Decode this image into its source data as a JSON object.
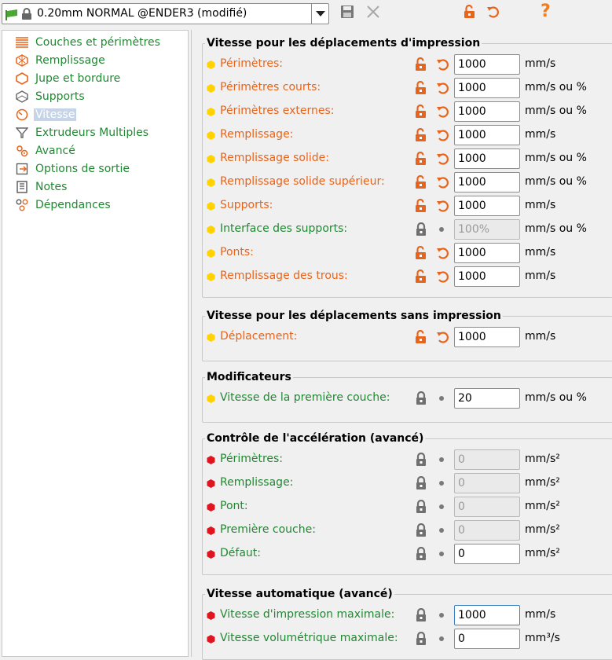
{
  "preset": {
    "name": "0.20mm NORMAL @ENDER3 (modifié)"
  },
  "colors": {
    "modified": "#e8641b",
    "system": "#218833",
    "bullet_yellow": "#ffd200",
    "bullet_red": "#e0141e"
  },
  "sidebar": {
    "items": [
      {
        "label": "Couches et périmètres",
        "icon": "layers-icon"
      },
      {
        "label": "Remplissage",
        "icon": "infill-icon"
      },
      {
        "label": "Jupe et bordure",
        "icon": "skirt-icon"
      },
      {
        "label": "Supports",
        "icon": "support-icon"
      },
      {
        "label": "Vitesse",
        "icon": "speed-icon",
        "selected": true
      },
      {
        "label": "Extrudeurs Multiples",
        "icon": "extruder-icon"
      },
      {
        "label": "Avancé",
        "icon": "advanced-icon"
      },
      {
        "label": "Options de sortie",
        "icon": "output-icon"
      },
      {
        "label": "Notes",
        "icon": "notes-icon"
      },
      {
        "label": "Dépendances",
        "icon": "dependencies-icon"
      }
    ]
  },
  "groups": [
    {
      "title": "Vitesse pour les déplacements d'impression",
      "rows": [
        {
          "label": "Périmètres:",
          "value": "1000",
          "unit": "mm/s",
          "modified": true,
          "bullet": "yellow",
          "enabled": true
        },
        {
          "label": "Périmètres courts:",
          "value": "1000",
          "unit": "mm/s ou %",
          "modified": true,
          "bullet": "yellow",
          "enabled": true
        },
        {
          "label": "Périmètres externes:",
          "value": "1000",
          "unit": "mm/s ou %",
          "modified": true,
          "bullet": "yellow",
          "enabled": true
        },
        {
          "label": "Remplissage:",
          "value": "1000",
          "unit": "mm/s",
          "modified": true,
          "bullet": "yellow",
          "enabled": true
        },
        {
          "label": "Remplissage solide:",
          "value": "1000",
          "unit": "mm/s ou %",
          "modified": true,
          "bullet": "yellow",
          "enabled": true
        },
        {
          "label": "Remplissage solide supérieur:",
          "value": "1000",
          "unit": "mm/s ou %",
          "modified": true,
          "bullet": "yellow",
          "enabled": true
        },
        {
          "label": "Supports:",
          "value": "1000",
          "unit": "mm/s",
          "modified": true,
          "bullet": "yellow",
          "enabled": true
        },
        {
          "label": "Interface des supports:",
          "value": "100%",
          "unit": "mm/s ou %",
          "modified": false,
          "bullet": "yellow",
          "enabled": false
        },
        {
          "label": "Ponts:",
          "value": "1000",
          "unit": "mm/s",
          "modified": true,
          "bullet": "yellow",
          "enabled": true
        },
        {
          "label": "Remplissage des trous:",
          "value": "1000",
          "unit": "mm/s",
          "modified": true,
          "bullet": "yellow",
          "enabled": true
        }
      ]
    },
    {
      "title": "Vitesse pour les déplacements sans impression",
      "rows": [
        {
          "label": "Déplacement:",
          "value": "1000",
          "unit": "mm/s",
          "modified": true,
          "bullet": "yellow",
          "enabled": true
        }
      ]
    },
    {
      "title": "Modificateurs",
      "rows": [
        {
          "label": "Vitesse de la première couche:",
          "value": "20",
          "unit": "mm/s ou %",
          "modified": false,
          "bullet": "yellow",
          "enabled": true
        }
      ]
    },
    {
      "title": "Contrôle de l'accélération (avancé)",
      "rows": [
        {
          "label": "Périmètres:",
          "value": "0",
          "unit": "mm/s²",
          "modified": false,
          "bullet": "red",
          "enabled": false
        },
        {
          "label": "Remplissage:",
          "value": "0",
          "unit": "mm/s²",
          "modified": false,
          "bullet": "red",
          "enabled": false
        },
        {
          "label": "Pont:",
          "value": "0",
          "unit": "mm/s²",
          "modified": false,
          "bullet": "red",
          "enabled": false
        },
        {
          "label": "Première couche:",
          "value": "0",
          "unit": "mm/s²",
          "modified": false,
          "bullet": "red",
          "enabled": false
        },
        {
          "label": "Défaut:",
          "value": "0",
          "unit": "mm/s²",
          "modified": false,
          "bullet": "red",
          "enabled": true
        }
      ]
    },
    {
      "title": "Vitesse automatique (avancé)",
      "rows": [
        {
          "label": "Vitesse d'impression maximale:",
          "value": "1000",
          "unit": "mm/s",
          "modified": false,
          "bullet": "red",
          "enabled": true,
          "focused": true
        },
        {
          "label": "Vitesse volumétrique maximale:",
          "value": "0",
          "unit": "mm³/s",
          "modified": false,
          "bullet": "red",
          "enabled": true
        }
      ]
    }
  ]
}
